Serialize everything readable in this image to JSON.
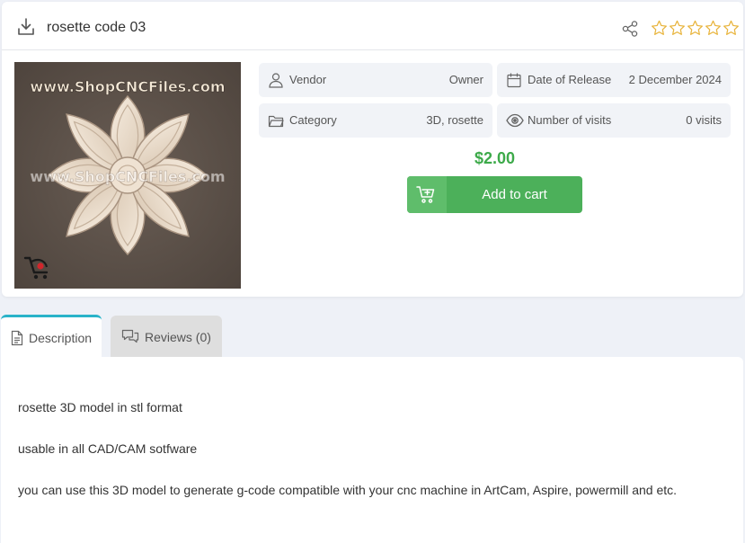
{
  "product": {
    "title": "rosette code 03",
    "rating_stars": 0,
    "rating_max": 5
  },
  "image": {
    "watermark_top": "www.ShopCNCFiles.com",
    "watermark_mid": "www.ShopCNCFiles.com"
  },
  "info": {
    "vendor_label": "Vendor",
    "vendor_value": "Owner",
    "release_label": "Date of Release",
    "release_value": "2 December 2024",
    "category_label": "Category",
    "category_value": "3D, rosette",
    "visits_label": "Number of visits",
    "visits_value": "0 visits"
  },
  "price": "$2.00",
  "cart_button": {
    "label": "Add to cart"
  },
  "tabs": [
    {
      "label": "Description",
      "active": true
    },
    {
      "label": "Reviews (0)",
      "active": false
    }
  ],
  "description": [
    "rosette 3D model in stl format",
    "usable in all CAD/CAM sotfware",
    "you can use this 3D model to generate g-code compatible with your cnc machine in ArtCam, Aspire, powermill and etc."
  ],
  "colors": {
    "accent_green": "#3daa4a",
    "button_green": "#4cb05a",
    "star_gold": "#e8b43c",
    "active_tab_border": "#29b3c9"
  },
  "icons": {
    "download": "download-icon",
    "share": "share-icon",
    "star": "star-outline-icon",
    "vendor": "user-icon",
    "release": "calendar-icon",
    "category": "folder-icon",
    "visits": "eye-icon",
    "cart": "cart-add-icon",
    "description_tab": "document-icon",
    "reviews_tab": "chat-bubbles-icon"
  }
}
